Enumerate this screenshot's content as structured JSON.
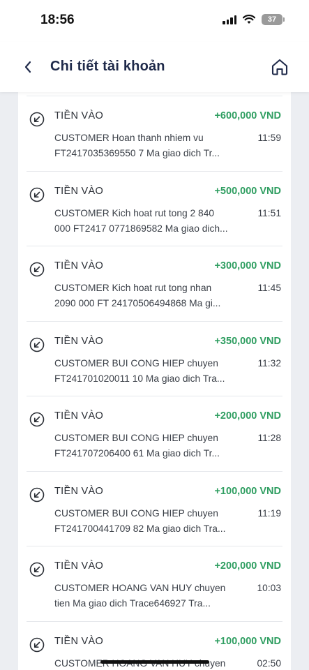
{
  "status_bar": {
    "time": "18:56",
    "battery": "37"
  },
  "header": {
    "title": "Chi tiết tài khoản"
  },
  "transactions": [
    {
      "type": "TIỀN VÀO",
      "amount": "+600,000 VND",
      "line1": "CUSTOMER Hoan thanh nhiem vu",
      "time": "11:59",
      "line2": "FT2417035369550 7   Ma giao dich  Tr..."
    },
    {
      "type": "TIỀN VÀO",
      "amount": "+500,000 VND",
      "line1": "CUSTOMER Kich hoat rut tong 2 840",
      "time": "11:51",
      "line2": "000 FT2417 0771869582   Ma giao dich..."
    },
    {
      "type": "TIỀN VÀO",
      "amount": "+300,000 VND",
      "line1": "CUSTOMER Kich hoat rut tong nhan",
      "time": "11:45",
      "line2": "2090 000 FT 24170506494868   Ma gi..."
    },
    {
      "type": "TIỀN VÀO",
      "amount": "+350,000 VND",
      "line1": "CUSTOMER BUI CONG HIEP chuyen",
      "time": "11:32",
      "line2": "FT241701020011 10   Ma giao dich  Tra..."
    },
    {
      "type": "TIỀN VÀO",
      "amount": "+200,000 VND",
      "line1": "CUSTOMER BUI CONG HIEP chuyen",
      "time": "11:28",
      "line2": "FT241707206400 61   Ma giao dich  Tr..."
    },
    {
      "type": "TIỀN VÀO",
      "amount": "+100,000 VND",
      "line1": "CUSTOMER BUI CONG HIEP chuyen",
      "time": "11:19",
      "line2": "FT241700441709 82   Ma giao dich  Tra..."
    },
    {
      "type": "TIỀN VÀO",
      "amount": "+200,000 VND",
      "line1": "CUSTOMER HOANG VAN HUY chuyen",
      "time": "10:03",
      "line2": "tien   Ma giao dich  Trace646927 Tra..."
    },
    {
      "type": "TIỀN VÀO",
      "amount": "+100,000 VND",
      "line1": "CUSTOMER HOANG VAN HUY chuyen",
      "time": "02:50",
      "line2": ""
    }
  ],
  "colors": {
    "amount_in": "#2f9e61",
    "title": "#1f2a4a"
  },
  "icons": {
    "back": "chevron-left-icon",
    "home": "home-icon",
    "incoming": "arrow-down-left-circle-icon"
  }
}
